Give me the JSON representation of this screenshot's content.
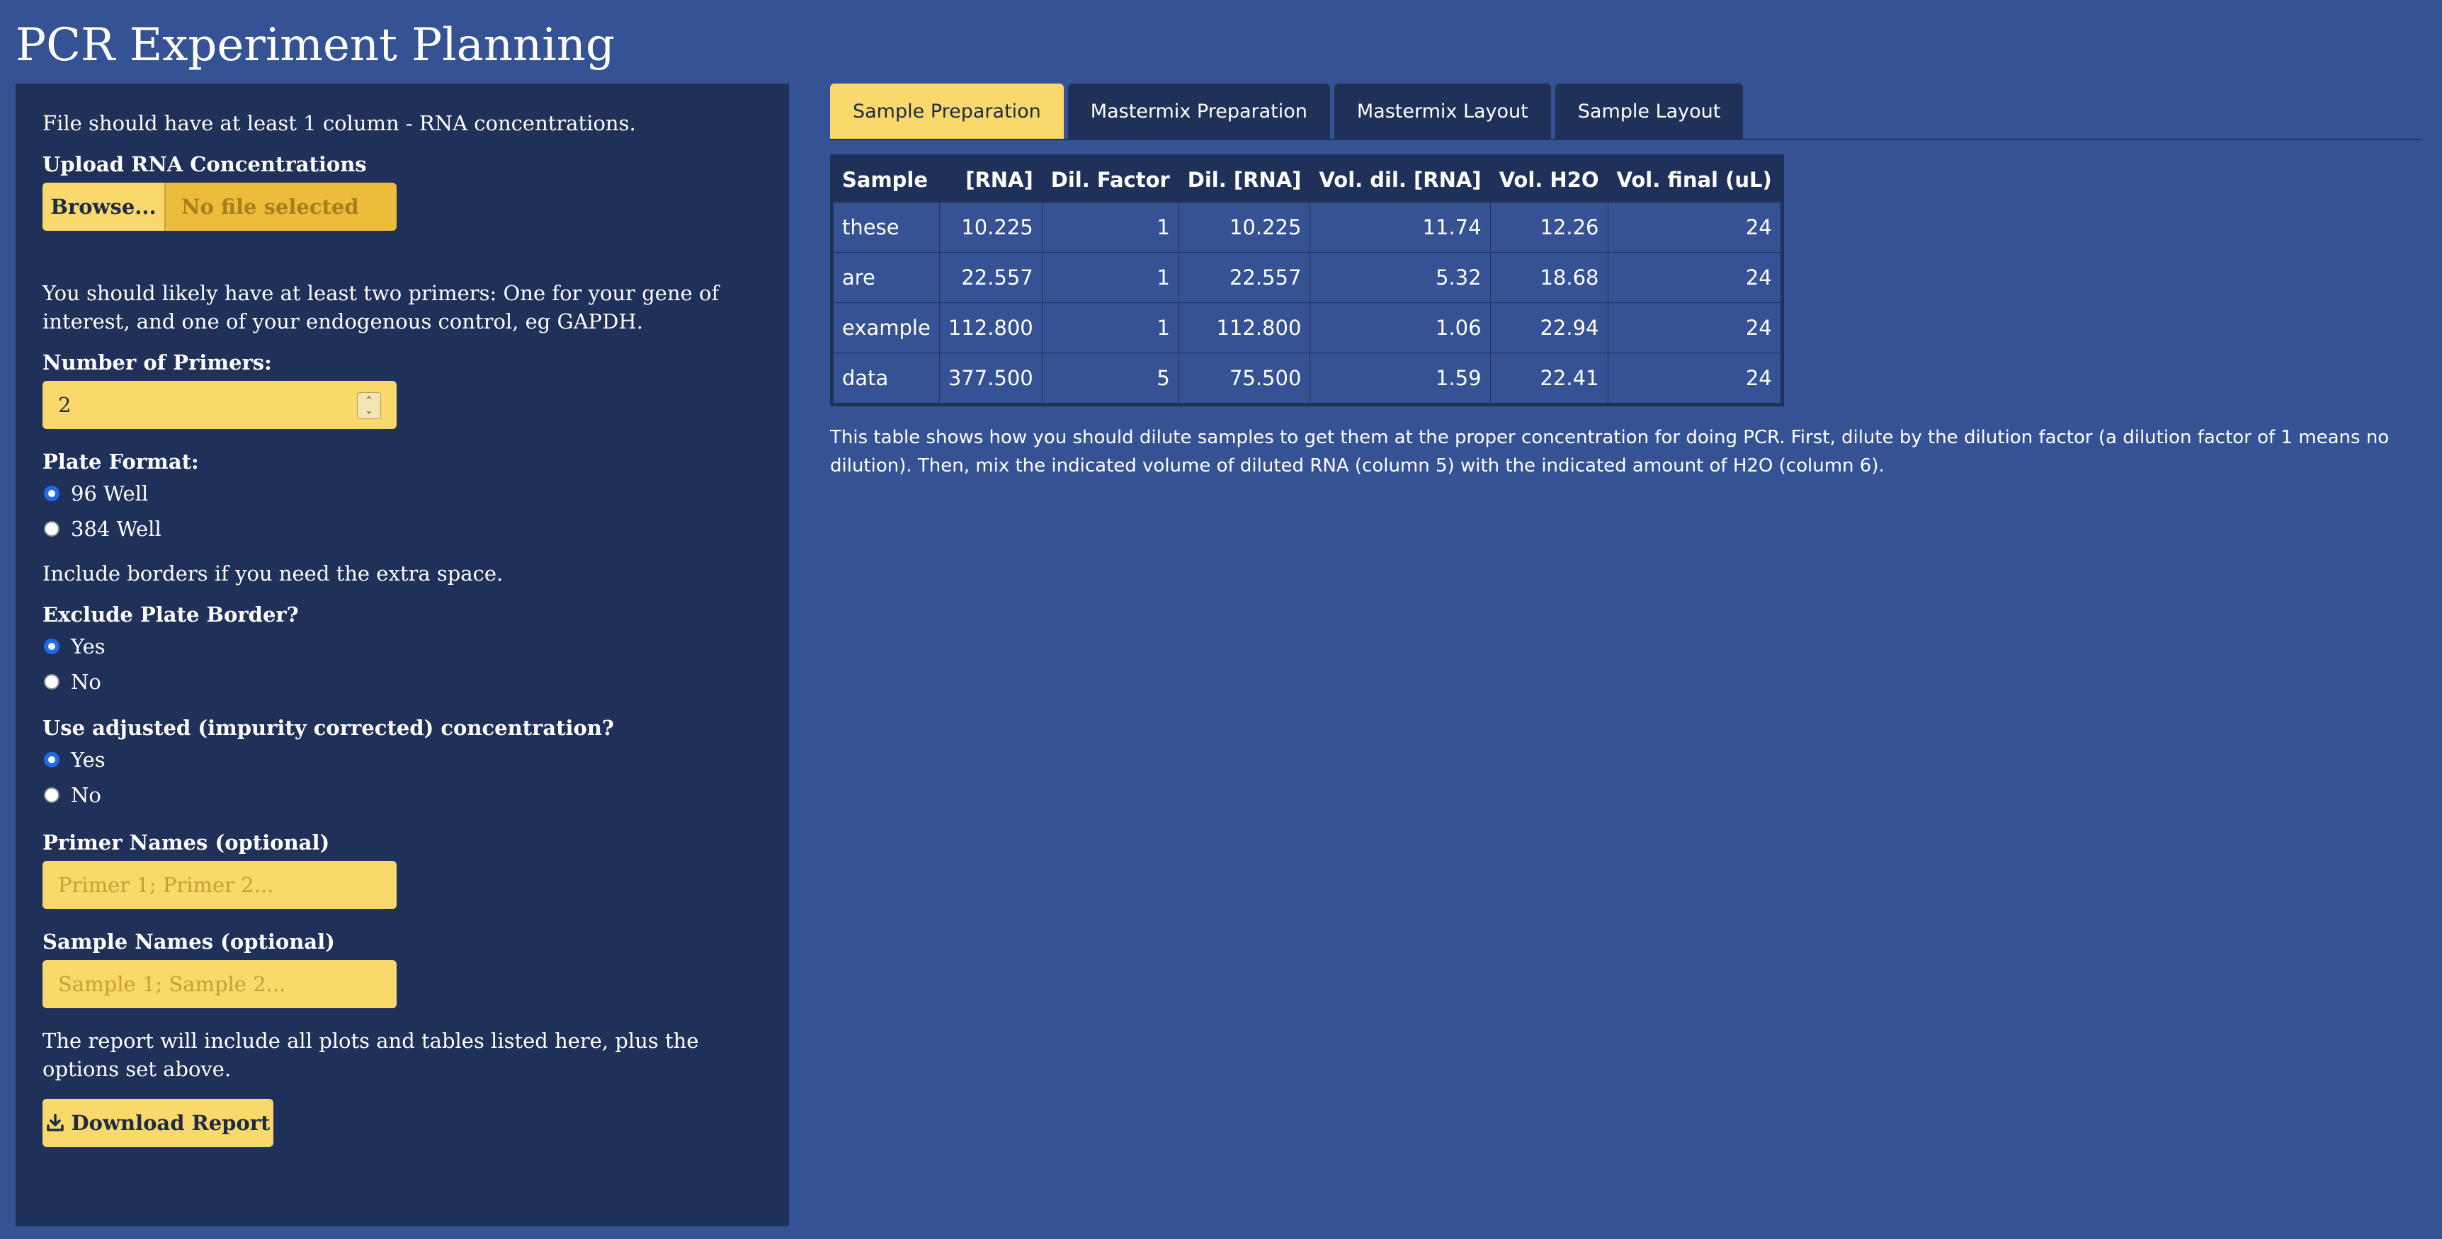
{
  "page": {
    "title": "PCR Experiment Planning"
  },
  "sidebar": {
    "upload_help": "File should have at least 1 column - RNA concentrations.",
    "upload_label": "Upload RNA Concentrations",
    "browse_label": "Browse...",
    "file_placeholder": "No file selected",
    "primer_help": "You should likely have at least two primers: One for your gene of interest, and one of your endogenous control, eg GAPDH.",
    "num_primers_label": "Number of Primers:",
    "num_primers_value": "2",
    "plate_format_label": "Plate Format:",
    "plate_format_options": [
      "96 Well",
      "384 Well"
    ],
    "plate_format_selected": "96 Well",
    "border_help": "Include borders if you need the extra space.",
    "exclude_border_label": "Exclude Plate Border?",
    "exclude_border_options": [
      "Yes",
      "No"
    ],
    "exclude_border_selected": "Yes",
    "adjusted_label": "Use adjusted (impurity corrected) concentration?",
    "adjusted_options": [
      "Yes",
      "No"
    ],
    "adjusted_selected": "Yes",
    "primer_names_label": "Primer Names (optional)",
    "primer_names_placeholder": "Primer 1; Primer 2...",
    "sample_names_label": "Sample Names (optional)",
    "sample_names_placeholder": "Sample 1; Sample 2...",
    "report_help": "The report will include all plots and tables listed here, plus the options set above.",
    "download_label": "Download Report"
  },
  "tabs": [
    {
      "label": "Sample Preparation",
      "active": true
    },
    {
      "label": "Mastermix Preparation",
      "active": false
    },
    {
      "label": "Mastermix Layout",
      "active": false
    },
    {
      "label": "Sample Layout",
      "active": false
    }
  ],
  "table": {
    "headers": [
      "Sample",
      "[RNA]",
      "Dil. Factor",
      "Dil. [RNA]",
      "Vol. dil. [RNA]",
      "Vol. H2O",
      "Vol. final (uL)"
    ],
    "rows": [
      [
        "these",
        "10.225",
        "1",
        "10.225",
        "11.74",
        "12.26",
        "24"
      ],
      [
        "are",
        "22.557",
        "1",
        "22.557",
        "5.32",
        "18.68",
        "24"
      ],
      [
        "example",
        "112.800",
        "1",
        "112.800",
        "1.06",
        "22.94",
        "24"
      ],
      [
        "data",
        "377.500",
        "5",
        "75.500",
        "1.59",
        "22.41",
        "24"
      ]
    ]
  },
  "caption": "This table shows how you should dilute samples to get them at the proper concentration for doing PCR. First, dilute by the dilution factor (a dilution factor of 1 means no dilution). Then, mix the indicated volume of diluted RNA (column 5) with the indicated amount of H2O (column 6).",
  "colors": {
    "background": "#355294",
    "panel": "#1f3059",
    "accent": "#f9d86c",
    "radio_checked": "#1d6be8"
  }
}
